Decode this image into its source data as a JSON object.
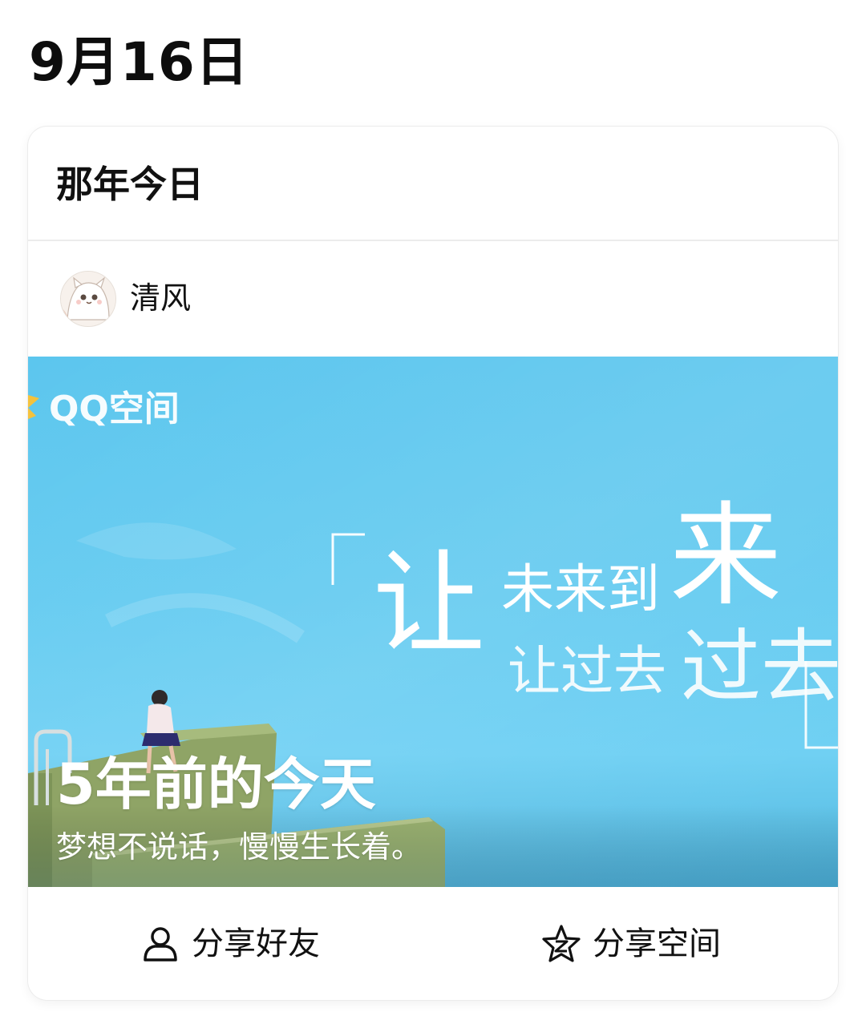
{
  "date_title": "9月16日",
  "card": {
    "title": "那年今日",
    "author": {
      "name": "清风"
    },
    "banner": {
      "brand": "QQ空间",
      "tagline_big": "让",
      "tagline_mid": "未来到",
      "tagline_big2": "来",
      "tagline_line2_a": "让过去",
      "tagline_line2_b": "过去",
      "years_ago": "5年前的今天",
      "memory_text": "梦想不说话，慢慢生长着。"
    },
    "actions": [
      {
        "label": "分享好友",
        "icon": "person-icon"
      },
      {
        "label": "分享空间",
        "icon": "star-z-icon"
      }
    ]
  },
  "colors": {
    "sky": "#62caf0",
    "building": "#93a86a",
    "text_white": "#ffffff"
  }
}
